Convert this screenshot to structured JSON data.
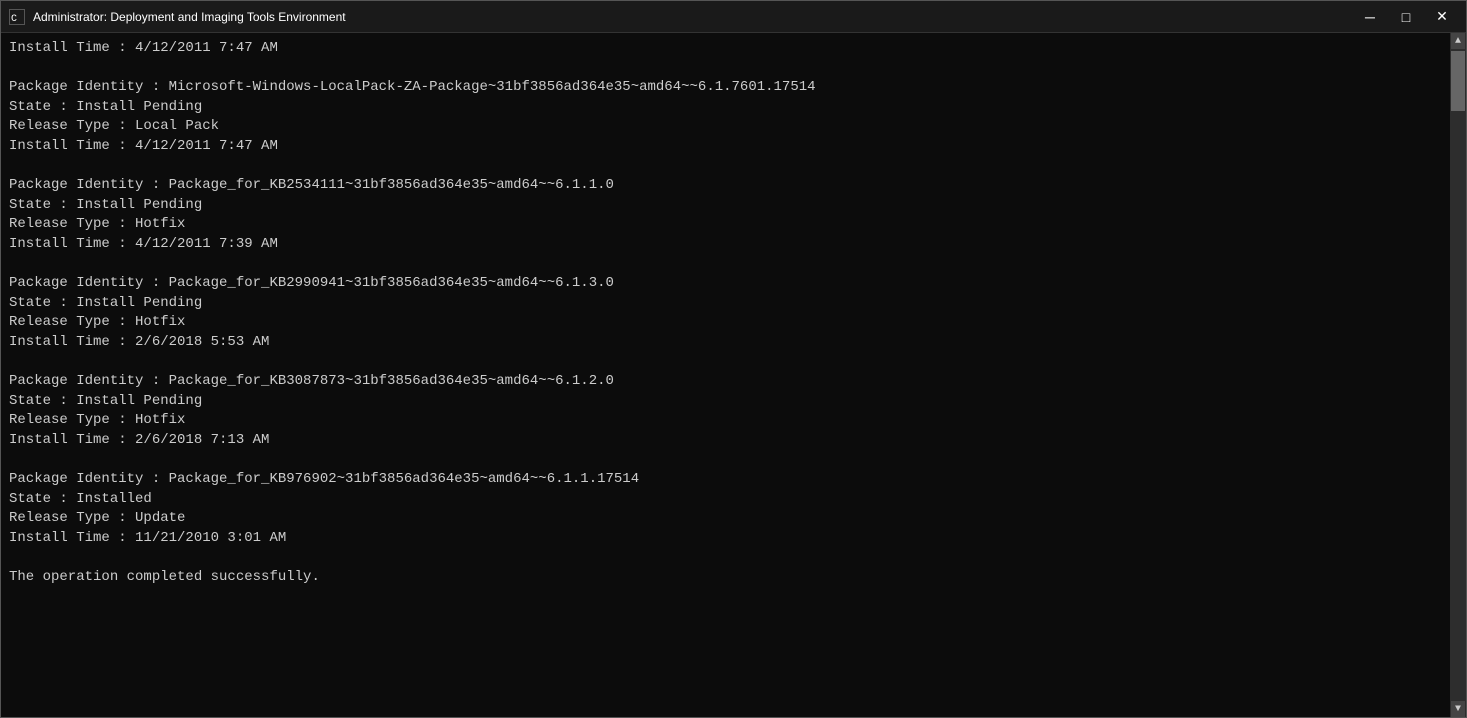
{
  "window": {
    "title": "Administrator: Deployment and Imaging Tools Environment",
    "icon_label": "cmd"
  },
  "titlebar": {
    "minimize_label": "─",
    "maximize_label": "□",
    "close_label": "✕"
  },
  "console": {
    "lines": [
      "Install Time : 4/12/2011 7:47 AM",
      "",
      "Package Identity : Microsoft-Windows-LocalPack-ZA-Package~31bf3856ad364e35~amd64~~6.1.7601.17514",
      "State : Install Pending",
      "Release Type : Local Pack",
      "Install Time : 4/12/2011 7:47 AM",
      "",
      "Package Identity : Package_for_KB2534111~31bf3856ad364e35~amd64~~6.1.1.0",
      "State : Install Pending",
      "Release Type : Hotfix",
      "Install Time : 4/12/2011 7:39 AM",
      "",
      "Package Identity : Package_for_KB2990941~31bf3856ad364e35~amd64~~6.1.3.0",
      "State : Install Pending",
      "Release Type : Hotfix",
      "Install Time : 2/6/2018 5:53 AM",
      "",
      "Package Identity : Package_for_KB3087873~31bf3856ad364e35~amd64~~6.1.2.0",
      "State : Install Pending",
      "Release Type : Hotfix",
      "Install Time : 2/6/2018 7:13 AM",
      "",
      "Package Identity : Package_for_KB976902~31bf3856ad364e35~amd64~~6.1.1.17514",
      "State : Installed",
      "Release Type : Update",
      "Install Time : 11/21/2010 3:01 AM",
      "",
      "The operation completed successfully."
    ]
  }
}
